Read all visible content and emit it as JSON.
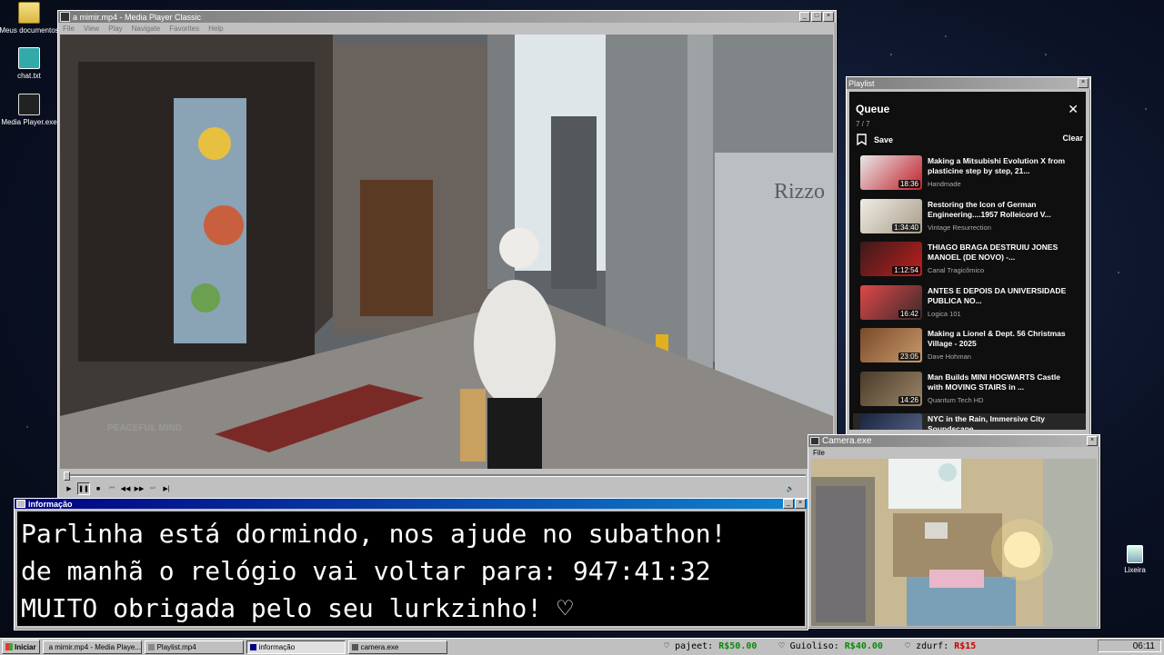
{
  "desktop_icons": [
    {
      "label": "Meus documentos",
      "icon": "folder-icon"
    },
    {
      "label": "chat.txt",
      "icon": "text-file-icon"
    },
    {
      "label": "Media Player.exe",
      "icon": "media-player-icon"
    },
    {
      "label": "Lixeira",
      "icon": "recycle-bin-icon"
    }
  ],
  "player": {
    "title": "a mimir.mp4 - Media Player Classic",
    "menu": [
      "File",
      "View",
      "Play",
      "Navigate",
      "Favorites",
      "Help"
    ],
    "watermark": "PEACEFUL MIND",
    "store_sign": "Rizzo"
  },
  "playlist_window": {
    "title": "Playlist",
    "heading": "Queue",
    "count": "7 / 7",
    "save_label": "Save",
    "clear_label": "Clear",
    "items": [
      {
        "title": "Making a Mitsubishi Evolution X from plasticine step by step, 21...",
        "channel": "Handmade",
        "duration": "18:36",
        "thumb_color": "#c9c9c9"
      },
      {
        "title": "Restoring the Icon of German Engineering....1957 Rolleicord V...",
        "channel": "Vintage Resurrection",
        "duration": "1:34:40",
        "thumb_color": "#d8d2c4"
      },
      {
        "title": "THIAGO BRAGA DESTRUIU JONES MANOEL (DE NOVO) -...",
        "channel": "Canal Tragicômico",
        "duration": "1:12:54",
        "thumb_color": "#6b2a2a"
      },
      {
        "title": "ANTES E DEPOIS DA UNIVERSIDADE PUBLICA NO...",
        "channel": "Logica 101",
        "duration": "16:42",
        "thumb_color": "#b7443d"
      },
      {
        "title": "Making a Lionel & Dept. 56 Christmas Village - 2025",
        "channel": "Dave Hohman",
        "duration": "23:05",
        "thumb_color": "#5a3b2a"
      },
      {
        "title": "Man Builds MINI HOGWARTS Castle with MOVING STAIRS in ...",
        "channel": "Quantum Tech HD",
        "duration": "14:26",
        "thumb_color": "#6d5a44"
      },
      {
        "title": "NYC in the Rain, Immersive City Soundscape",
        "channel": "",
        "duration": "",
        "thumb_color": "#2a3550"
      }
    ]
  },
  "info_window": {
    "title": "informação",
    "lines": [
      "Parlinha está dormindo, nos ajude no subathon!",
      "de manhã o relógio vai voltar para:  947:41:32",
      "MUITO obrigada pelo seu lurkzinho! ♡"
    ]
  },
  "camera_window": {
    "title": "Camera.exe",
    "menu": "File"
  },
  "taskbar": {
    "start_label": "Iniciar",
    "tasks": [
      {
        "label": "a mimir.mp4 - Media Playe...",
        "active": false
      },
      {
        "label": "Playlist.mp4",
        "active": false
      },
      {
        "label": "informação",
        "active": true
      },
      {
        "label": "camera.exe",
        "active": false
      }
    ],
    "ticker": [
      {
        "name": "pajeet:",
        "amount": "R$50.00"
      },
      {
        "name": "Guioliso:",
        "amount": "R$40.00"
      },
      {
        "name": "zdurf:",
        "amount": "R$15"
      }
    ],
    "clock": "06:11"
  }
}
